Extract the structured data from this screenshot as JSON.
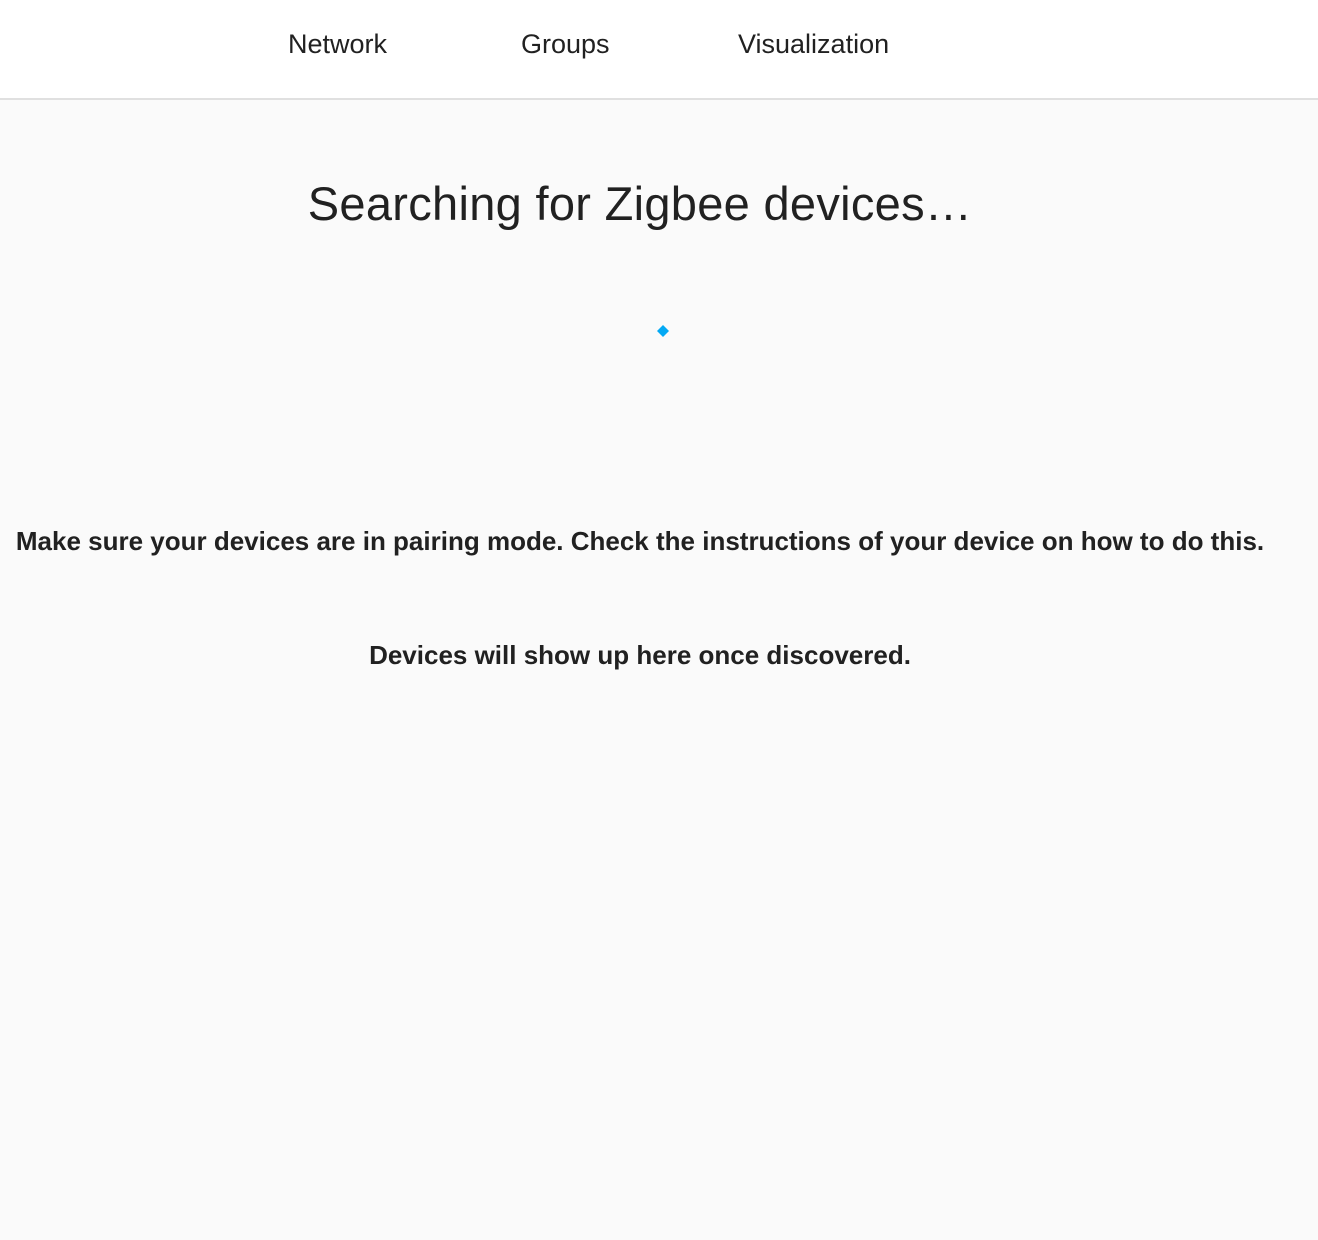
{
  "tabs": {
    "network": "Network",
    "groups": "Groups",
    "visualization": "Visualization"
  },
  "main": {
    "title": "Searching for Zigbee devices…",
    "pairing_hint": "Make sure your devices are in pairing mode. Check the instructions of your device on how to do this.",
    "discovered_hint": "Devices will show up here once discovered."
  },
  "spinner": {
    "icon": "loading-spinner-icon",
    "color": "#03a9f4"
  },
  "colors": {
    "background": "#fafafa",
    "header": "#ffffff",
    "text": "#212121",
    "accent": "#03a9f4"
  }
}
